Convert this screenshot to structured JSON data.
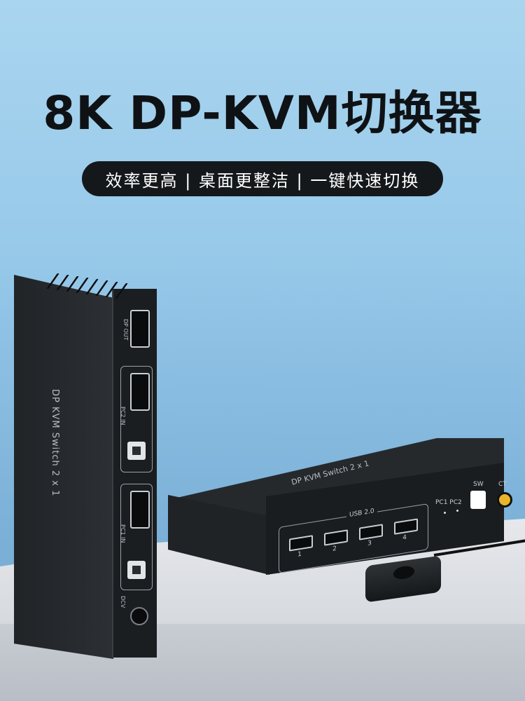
{
  "headline": "8K DP-KVM切换器",
  "tagline": "效率更高 | 桌面更整洁 | 一键快速切换",
  "vertical_device": {
    "label": "DP KVM Switch 2 x 1",
    "dp_out": "DP OUT",
    "pc2_in": "PC2 IN",
    "pc1_in": "PC1 IN",
    "dc_in": "DCV"
  },
  "horizontal_device": {
    "label": "DP KVM Switch 2 x 1",
    "usb_tag": "USB 2.0",
    "usb_ports": [
      "1",
      "2",
      "3",
      "4"
    ],
    "pc_leds": "PC1 PC2",
    "sw_label": "SW",
    "ct_label": "CT"
  },
  "colors": {
    "background": "#a9d5ef",
    "device": "#1b1e21",
    "pill": "#15181b",
    "ct_jack": "#e8b52a"
  }
}
